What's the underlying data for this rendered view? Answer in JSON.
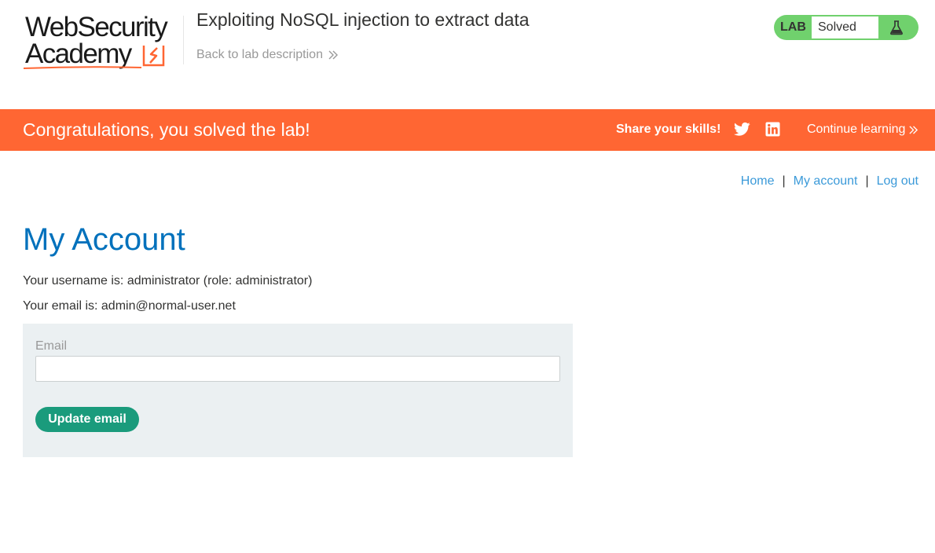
{
  "header": {
    "logo_line1": "WebSecurity",
    "logo_line2": "Academy",
    "lab_title": "Exploiting NoSQL injection to extract data",
    "back_link": "Back to lab description",
    "lab_badge": {
      "label": "LAB",
      "status": "Solved",
      "color": "#70d16d"
    }
  },
  "banner": {
    "message": "Congratulations, you solved the lab!",
    "share_label": "Share your skills!",
    "continue_label": "Continue learning",
    "color": "#ff6633"
  },
  "nav": {
    "home": "Home",
    "separator": "|",
    "my_account": "My account",
    "log_out": "Log out"
  },
  "account": {
    "title": "My Account",
    "username_line": "Your username is: administrator (role: administrator)",
    "email_line": "Your email is: admin@normal-user.net"
  },
  "form": {
    "email_label": "Email",
    "email_value": "",
    "submit_label": "Update email",
    "button_color": "#1a9b7c"
  }
}
